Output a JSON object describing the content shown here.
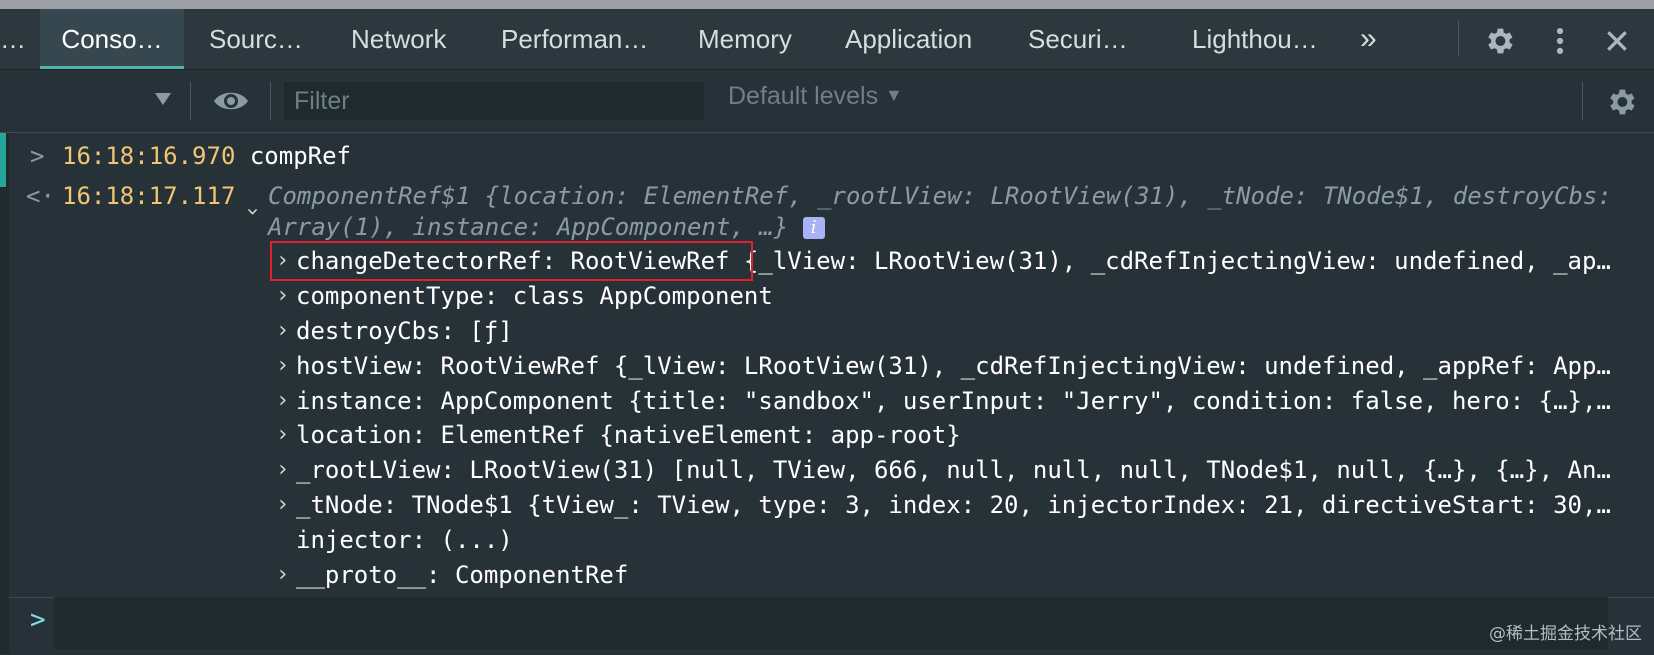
{
  "tabs": [
    "Conso…",
    "Sourc…",
    "Network",
    "Performan…",
    "Memory",
    "Application",
    "Securi…",
    "Lighthou…"
  ],
  "tab_ellipsis": "…",
  "more_tabs": "»",
  "icons": {
    "settings": "gear-icon",
    "more": "kebab-icon",
    "close": "close-icon",
    "eye": "eye-icon",
    "context_dropdown": "caret-down-icon",
    "console_settings": "gear-icon"
  },
  "toolbar": {
    "filter_placeholder": "Filter",
    "levels_label": "Default levels",
    "levels_caret": "▼",
    "context_caret": "▼"
  },
  "console": {
    "entry1": {
      "chevron": ">",
      "time": "16:18:16.970",
      "command": "compRef"
    },
    "entry2": {
      "chevron": "<·",
      "time": "16:18:17.117",
      "summary_line1": "ComponentRef$1 {location: ElementRef, _rootLView: LRootView(31), _tNode: TNode$1, destroyCbs:",
      "summary_line2": "Array(1), instance: AppComponent, …}",
      "info": "i"
    },
    "props": [
      {
        "text": "changeDetectorRef: RootViewRef {_lView: LRootView(31), _cdRefInjectingView: undefined, _ap…"
      },
      {
        "text": "componentType: class AppComponent"
      },
      {
        "text": "destroyCbs: [ƒ]"
      },
      {
        "text": "hostView: RootViewRef {_lView: LRootView(31), _cdRefInjectingView: undefined, _appRef: App…"
      },
      {
        "text": "instance: AppComponent {title: \"sandbox\", userInput: \"Jerry\", condition: false, hero: {…},…"
      },
      {
        "text": "location: ElementRef {nativeElement: app-root}"
      },
      {
        "text": "_rootLView: LRootView(31) [null, TView, 666, null, null, null, TNode$1, null, {…}, {…}, An…"
      },
      {
        "text": "_tNode: TNode$1 {tView_: TView, type: 3, index: 20, injectorIndex: 21, directiveStart: 30,…"
      },
      {
        "text": "injector: (...)"
      },
      {
        "text": "__proto__: ComponentRef"
      }
    ],
    "prompt": ">"
  },
  "watermark": "@稀土掘金技术社区",
  "colors": {
    "accent": "#26a69a",
    "highlight_box": "#e0202a",
    "timestamp": "#f0c674"
  }
}
